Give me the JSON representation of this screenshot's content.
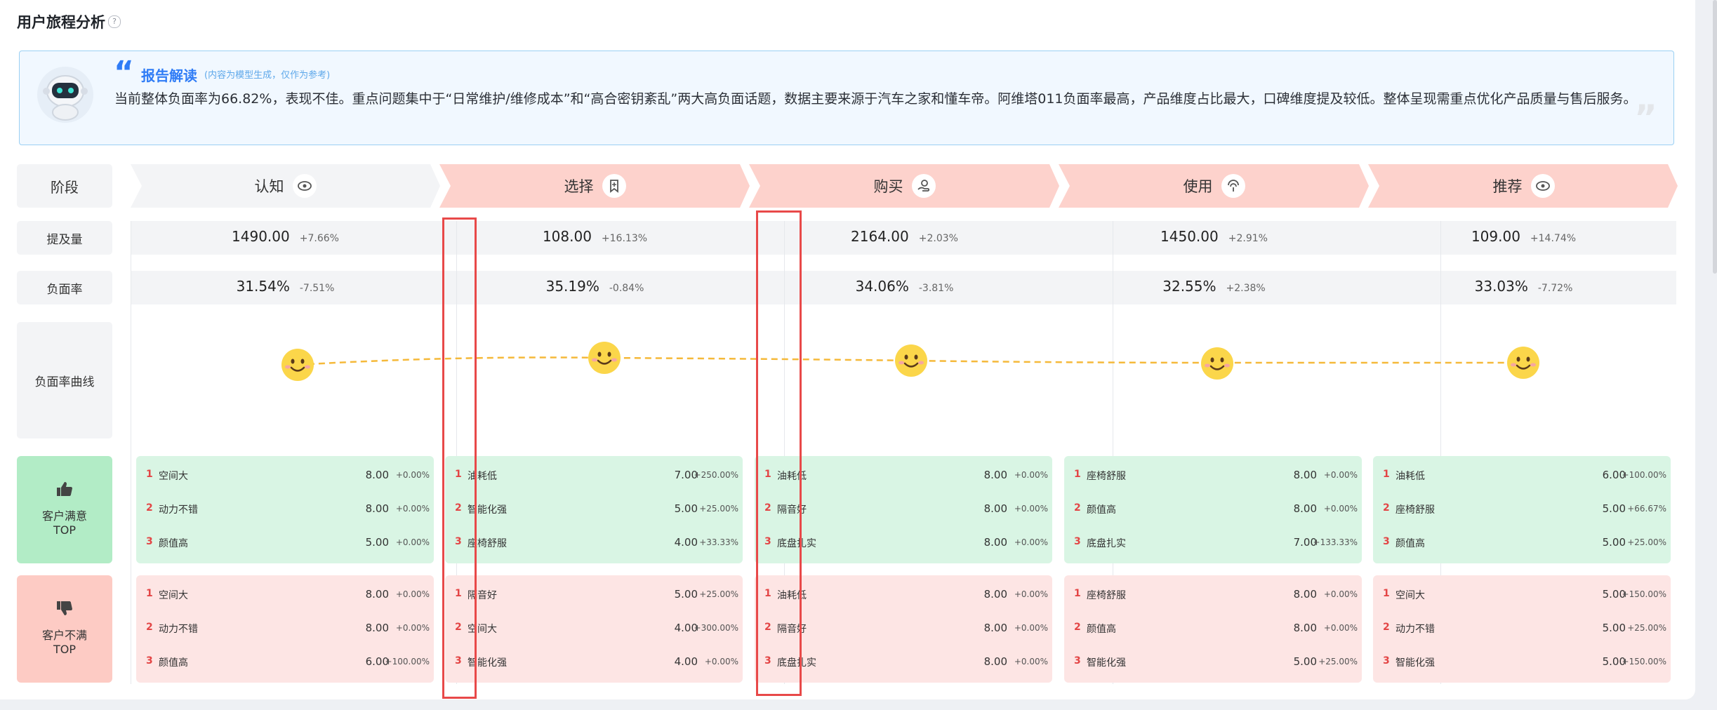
{
  "header": {
    "title": "用户旅程分析",
    "help_icon": "?"
  },
  "report": {
    "title": "报告解读",
    "subtitle": "(内容为模型生成，仅作为参考)",
    "body": "当前整体负面率为66.82%，表现不佳。重点问题集中于“日常维护/维修成本”和“高合密钥紊乱”两大高负面话题，数据主要来源于汽车之家和懂车帝。阿维塔011负面率最高，产品维度占比最大，口碑维度提及较低。整体呈现需重点优化产品质量与售后服务。"
  },
  "row_labels": {
    "stage": "阶段",
    "mentions": "提及量",
    "neg_rate": "负面率",
    "curve": "负面率曲线",
    "satisfied": "客户满意",
    "dissatisfied": "客户不满",
    "top": "TOP"
  },
  "stages": [
    {
      "name": "认知",
      "icon": "eye-icon",
      "mentions": "1490.00",
      "mentions_change": "+7.66%",
      "neg_rate": "31.54%",
      "neg_change": "-7.51%",
      "satisfied": [
        {
          "rank": "1",
          "name": "空间大",
          "value": "8.00",
          "change": "+0.00%"
        },
        {
          "rank": "2",
          "name": "动力不错",
          "value": "8.00",
          "change": "+0.00%"
        },
        {
          "rank": "3",
          "name": "颜值高",
          "value": "5.00",
          "change": "+0.00%"
        }
      ],
      "dissatisfied": [
        {
          "rank": "1",
          "name": "空间大",
          "value": "8.00",
          "change": "+0.00%"
        },
        {
          "rank": "2",
          "name": "动力不错",
          "value": "8.00",
          "change": "+0.00%"
        },
        {
          "rank": "3",
          "name": "颜值高",
          "value": "6.00",
          "change": "+100.00%"
        }
      ]
    },
    {
      "name": "选择",
      "icon": "bookmark-icon",
      "mentions": "108.00",
      "mentions_change": "+16.13%",
      "neg_rate": "35.19%",
      "neg_change": "-0.84%",
      "satisfied": [
        {
          "rank": "1",
          "name": "油耗低",
          "value": "7.00",
          "change": "+250.00%"
        },
        {
          "rank": "2",
          "name": "智能化强",
          "value": "5.00",
          "change": "+25.00%"
        },
        {
          "rank": "3",
          "name": "座椅舒服",
          "value": "4.00",
          "change": "+33.33%"
        }
      ],
      "dissatisfied": [
        {
          "rank": "1",
          "name": "隔音好",
          "value": "5.00",
          "change": "+25.00%"
        },
        {
          "rank": "2",
          "name": "空间大",
          "value": "4.00",
          "change": "+300.00%"
        },
        {
          "rank": "3",
          "name": "智能化强",
          "value": "4.00",
          "change": "+0.00%"
        }
      ]
    },
    {
      "name": "购买",
      "icon": "hand-coin-icon",
      "mentions": "2164.00",
      "mentions_change": "+2.03%",
      "neg_rate": "34.06%",
      "neg_change": "-3.81%",
      "satisfied": [
        {
          "rank": "1",
          "name": "油耗低",
          "value": "8.00",
          "change": "+0.00%"
        },
        {
          "rank": "2",
          "name": "隔音好",
          "value": "8.00",
          "change": "+0.00%"
        },
        {
          "rank": "3",
          "name": "底盘扎实",
          "value": "8.00",
          "change": "+0.00%"
        }
      ],
      "dissatisfied": [
        {
          "rank": "1",
          "name": "油耗低",
          "value": "8.00",
          "change": "+0.00%"
        },
        {
          "rank": "2",
          "name": "隔音好",
          "value": "8.00",
          "change": "+0.00%"
        },
        {
          "rank": "3",
          "name": "底盘扎实",
          "value": "8.00",
          "change": "+0.00%"
        }
      ]
    },
    {
      "name": "使用",
      "icon": "signal-icon",
      "mentions": "1450.00",
      "mentions_change": "+2.91%",
      "neg_rate": "32.55%",
      "neg_change": "+2.38%",
      "satisfied": [
        {
          "rank": "1",
          "name": "座椅舒服",
          "value": "8.00",
          "change": "+0.00%"
        },
        {
          "rank": "2",
          "name": "颜值高",
          "value": "8.00",
          "change": "+0.00%"
        },
        {
          "rank": "3",
          "name": "底盘扎实",
          "value": "7.00",
          "change": "+133.33%"
        }
      ],
      "dissatisfied": [
        {
          "rank": "1",
          "name": "座椅舒服",
          "value": "8.00",
          "change": "+0.00%"
        },
        {
          "rank": "2",
          "name": "颜值高",
          "value": "8.00",
          "change": "+0.00%"
        },
        {
          "rank": "3",
          "name": "智能化强",
          "value": "5.00",
          "change": "+25.00%"
        }
      ]
    },
    {
      "name": "推荐",
      "icon": "eye-icon",
      "mentions": "109.00",
      "mentions_change": "+14.74%",
      "neg_rate": "33.03%",
      "neg_change": "-7.72%",
      "satisfied": [
        {
          "rank": "1",
          "name": "油耗低",
          "value": "6.00",
          "change": "+100.00%"
        },
        {
          "rank": "2",
          "name": "座椅舒服",
          "value": "5.00",
          "change": "+66.67%"
        },
        {
          "rank": "3",
          "name": "颜值高",
          "value": "5.00",
          "change": "+25.00%"
        }
      ],
      "dissatisfied": [
        {
          "rank": "1",
          "name": "空间大",
          "value": "5.00",
          "change": "+150.00%"
        },
        {
          "rank": "2",
          "name": "动力不错",
          "value": "5.00",
          "change": "+25.00%"
        },
        {
          "rank": "3",
          "name": "智能化强",
          "value": "5.00",
          "change": "+150.00%"
        }
      ]
    }
  ],
  "colors": {
    "stage_first": "#f3f4f6",
    "stage_active": "#fdd2cc",
    "satisfied_bg": "#d9f5e4",
    "dissatisfied_bg": "#fde5e4",
    "satisfied_label": "#b2ecc6",
    "dissatisfied_label": "#fdcbc4",
    "curve": "#f5b93a",
    "accent": "#2f7cf6",
    "rank": "#e34545",
    "highlight": "#e84949"
  }
}
